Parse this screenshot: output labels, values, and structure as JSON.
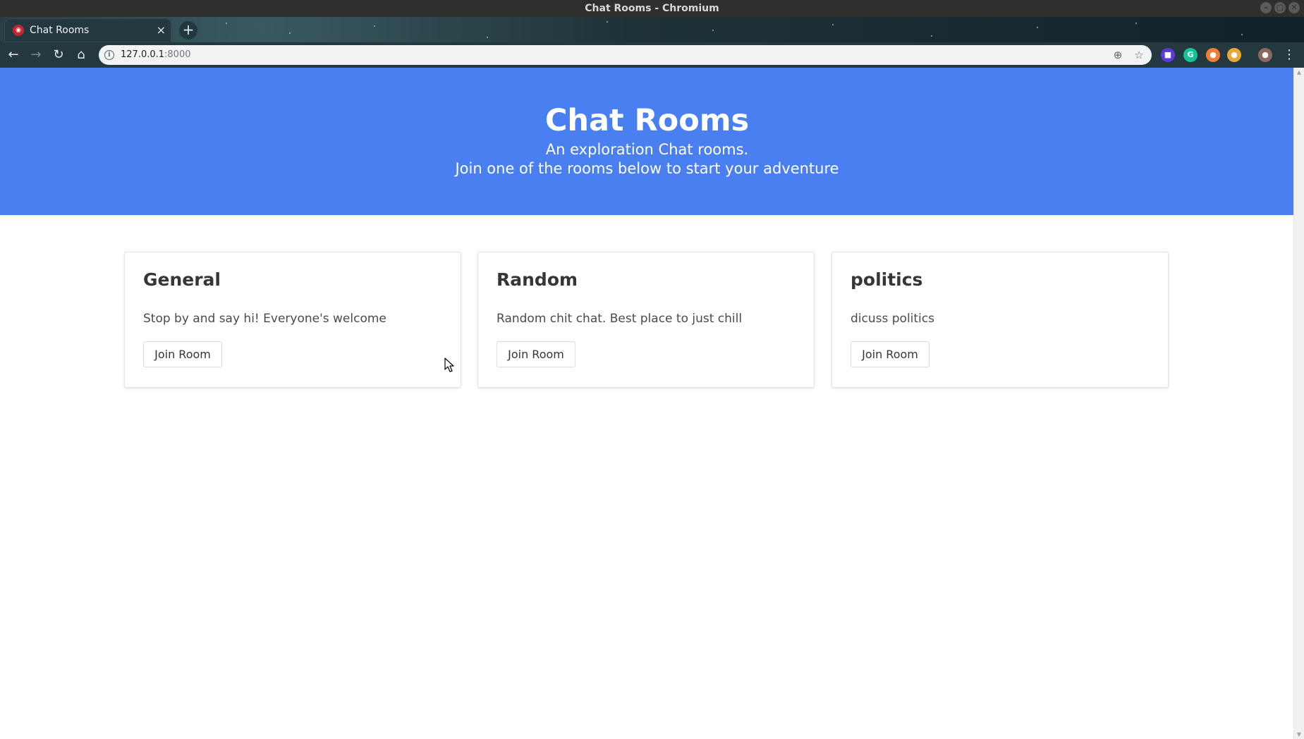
{
  "window": {
    "title": "Chat Rooms - Chromium",
    "controls": [
      "–",
      "▢",
      "✕"
    ]
  },
  "tab": {
    "title": "Chat Rooms",
    "favicon": "favicon-icon",
    "close": "×"
  },
  "toolbar": {
    "new_tab": "+",
    "back": "←",
    "forward": "→",
    "reload": "↻",
    "home": "⌂",
    "url_host": "127.0.0.1",
    "url_port": ":8000",
    "info": "i",
    "zoom": "⊕",
    "bookmark": "☆",
    "menu": "⋮"
  },
  "extensions": [
    {
      "name": "extension-icon",
      "glyph": "■",
      "color": "#5f3ad8"
    },
    {
      "name": "grammarly-icon",
      "glyph": "G",
      "color": "#15c39a"
    },
    {
      "name": "extension-icon",
      "glyph": "●",
      "color": "#f07d3a"
    },
    {
      "name": "extension-icon",
      "glyph": "●",
      "color": "#e8a838"
    },
    {
      "name": "profile-avatar-icon",
      "glyph": "●",
      "color": "#8a6a5c"
    }
  ],
  "hero": {
    "title": "Chat Rooms",
    "subtitle_line1": "An exploration Chat rooms.",
    "subtitle_line2": "Join one of the rooms below to start your adventure"
  },
  "rooms": [
    {
      "name": "General",
      "description": "Stop by and say hi! Everyone's welcome",
      "button": "Join Room"
    },
    {
      "name": "Random",
      "description": "Random chit chat. Best place to just chill",
      "button": "Join Room"
    },
    {
      "name": "politics",
      "description": "dicuss politics",
      "button": "Join Room"
    }
  ],
  "colors": {
    "hero_bg": "#4a7ff2",
    "titlebar_bg": "#2f2f2d",
    "toolbar_bg": "#23393f"
  }
}
